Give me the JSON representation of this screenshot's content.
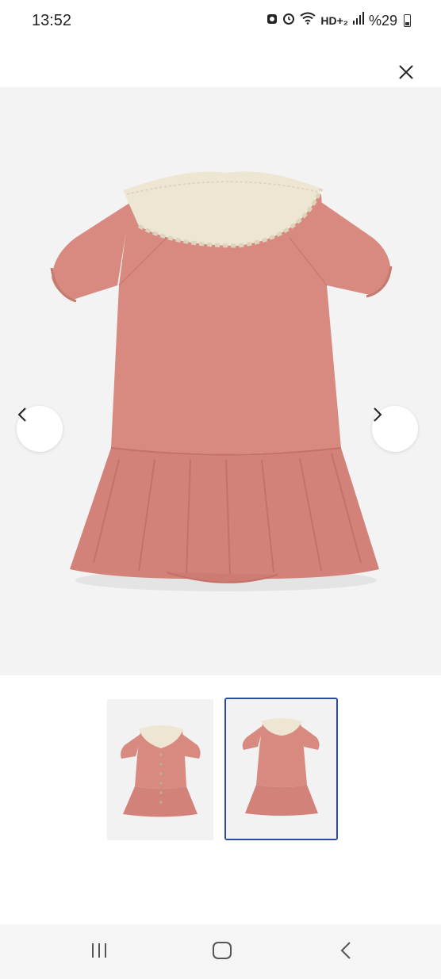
{
  "status_bar": {
    "time": "13:52",
    "icons": [
      "alarm-clock-icon",
      "notification-icon",
      "wifi-icon",
      "hd-volte-icon",
      "signal-icon"
    ],
    "network_label": "HD+₂",
    "battery_text": "%29"
  },
  "toolbar": {
    "close_icon": "close-icon"
  },
  "image_viewer": {
    "prev_icon": "chevron-left-icon",
    "next_icon": "chevron-right-icon",
    "active_index": 2,
    "image_count": 2
  },
  "thumbnails": [
    {
      "view": "front",
      "selected": false
    },
    {
      "view": "back",
      "selected": true
    }
  ],
  "colors": {
    "dress": "#d88a80",
    "collar": "#ece6d3",
    "background": "#f3f3f3",
    "selected_border": "#2b4a9b"
  },
  "system_nav": {
    "recents_icon": "recents-icon",
    "home_icon": "home-icon",
    "back_icon": "back-icon"
  }
}
